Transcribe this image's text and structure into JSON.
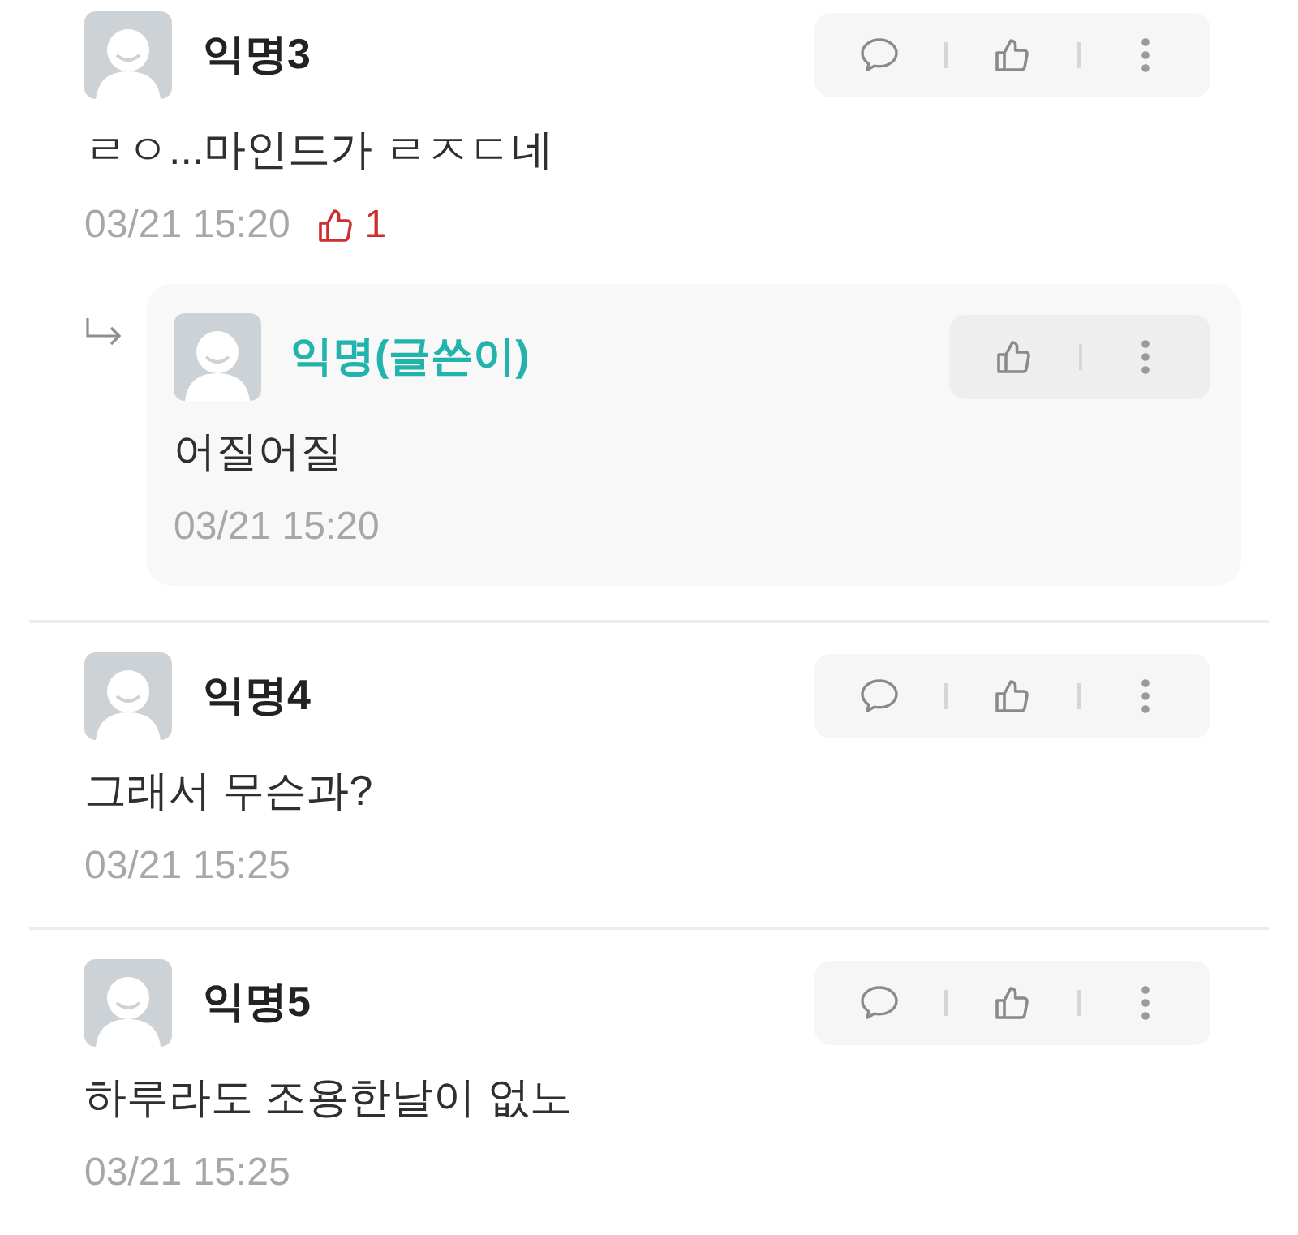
{
  "comments": [
    {
      "author": "익명3",
      "is_author": false,
      "text": "ㄹㅇ...마인드가 ㄹㅈㄷ네",
      "time": "03/21 15:20",
      "likes": "1",
      "actions": [
        {
          "kind": "reply"
        },
        {
          "kind": "like"
        },
        {
          "kind": "more"
        }
      ],
      "replies": [
        {
          "author": "익명(글쓴이)",
          "is_author": true,
          "text": "어질어질",
          "time": "03/21 15:20",
          "actions": [
            {
              "kind": "like"
            },
            {
              "kind": "more"
            }
          ]
        }
      ]
    },
    {
      "author": "익명4",
      "is_author": false,
      "text": "그래서 무슨과?",
      "time": "03/21 15:25",
      "actions": [
        {
          "kind": "reply"
        },
        {
          "kind": "like"
        },
        {
          "kind": "more"
        }
      ]
    },
    {
      "author": "익명5",
      "is_author": false,
      "text": "하루라도 조용한날이 없노",
      "time": "03/21 15:25",
      "actions": [
        {
          "kind": "reply"
        },
        {
          "kind": "like"
        },
        {
          "kind": "more"
        }
      ]
    }
  ]
}
